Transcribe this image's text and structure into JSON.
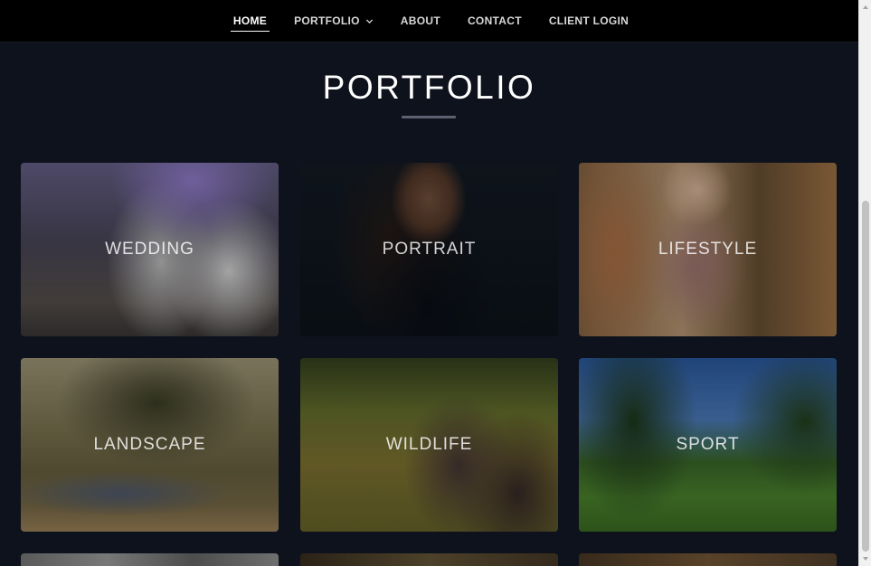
{
  "nav": {
    "items": [
      {
        "label": "HOME",
        "active": true
      },
      {
        "label": "PORTFOLIO",
        "has_dropdown": true
      },
      {
        "label": "ABOUT"
      },
      {
        "label": "CONTACT"
      },
      {
        "label": "CLIENT LOGIN"
      }
    ]
  },
  "main": {
    "title": "PORTFOLIO",
    "categories": [
      {
        "label": "WEDDING"
      },
      {
        "label": "PORTRAIT"
      },
      {
        "label": "LIFESTYLE"
      },
      {
        "label": "LANDSCAPE"
      },
      {
        "label": "WILDLIFE"
      },
      {
        "label": "SPORT"
      }
    ]
  },
  "colors": {
    "background": "#0e121c",
    "nav_background": "#000000",
    "text": "#ffffff",
    "title_rule": "#5a6170"
  }
}
